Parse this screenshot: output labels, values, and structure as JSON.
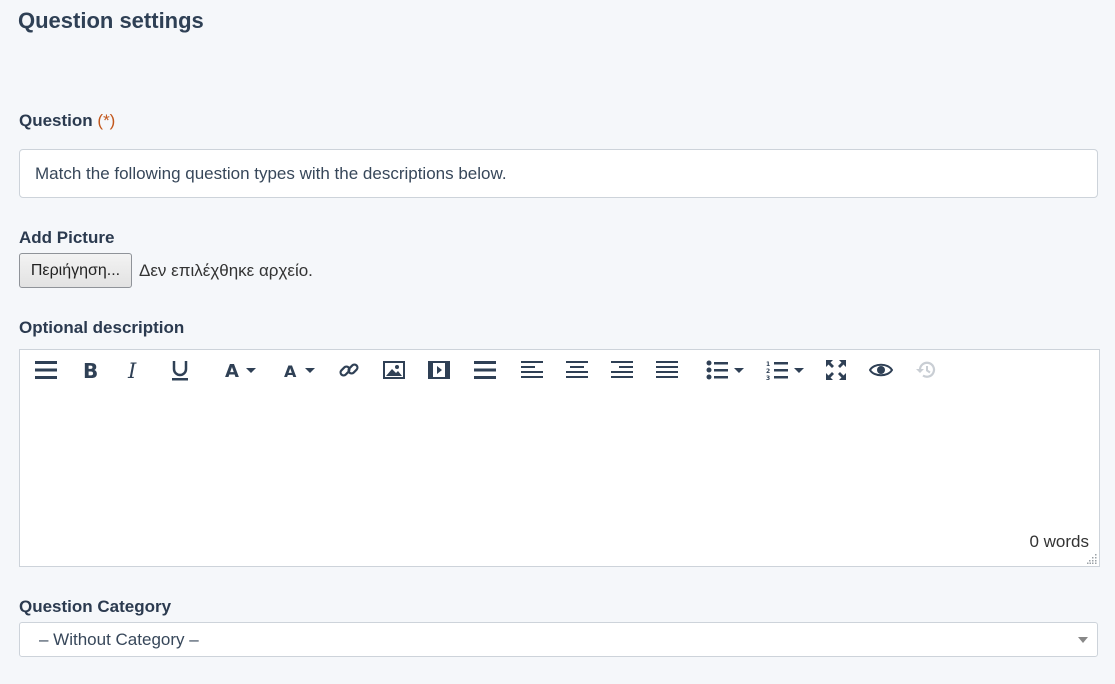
{
  "page": {
    "title": "Question settings"
  },
  "question": {
    "label": "Question",
    "required_marker": "(*)",
    "value": "Match the following question types with the descriptions below."
  },
  "picture": {
    "label": "Add Picture",
    "browse_label": "Περιήγηση...",
    "status": "Δεν επιλέχθηκε αρχείο."
  },
  "description": {
    "label": "Optional description",
    "word_count": "0 words",
    "toolbar": [
      "menu-icon",
      "bold-icon",
      "italic-icon",
      "underline-icon",
      "text-color-icon",
      "background-color-icon",
      "link-icon",
      "image-icon",
      "media-icon",
      "align-menu-icon",
      "align-left-icon",
      "align-center-icon",
      "align-right-icon",
      "align-justify-icon",
      "bullet-list-icon",
      "numbered-list-icon",
      "fullscreen-icon",
      "preview-icon",
      "restore-draft-icon"
    ]
  },
  "category": {
    "label": "Question Category",
    "selected": "– Without Category –"
  },
  "colors": {
    "accent": "#2f4055",
    "required": "#c2571c",
    "background": "#f5f7fa"
  }
}
